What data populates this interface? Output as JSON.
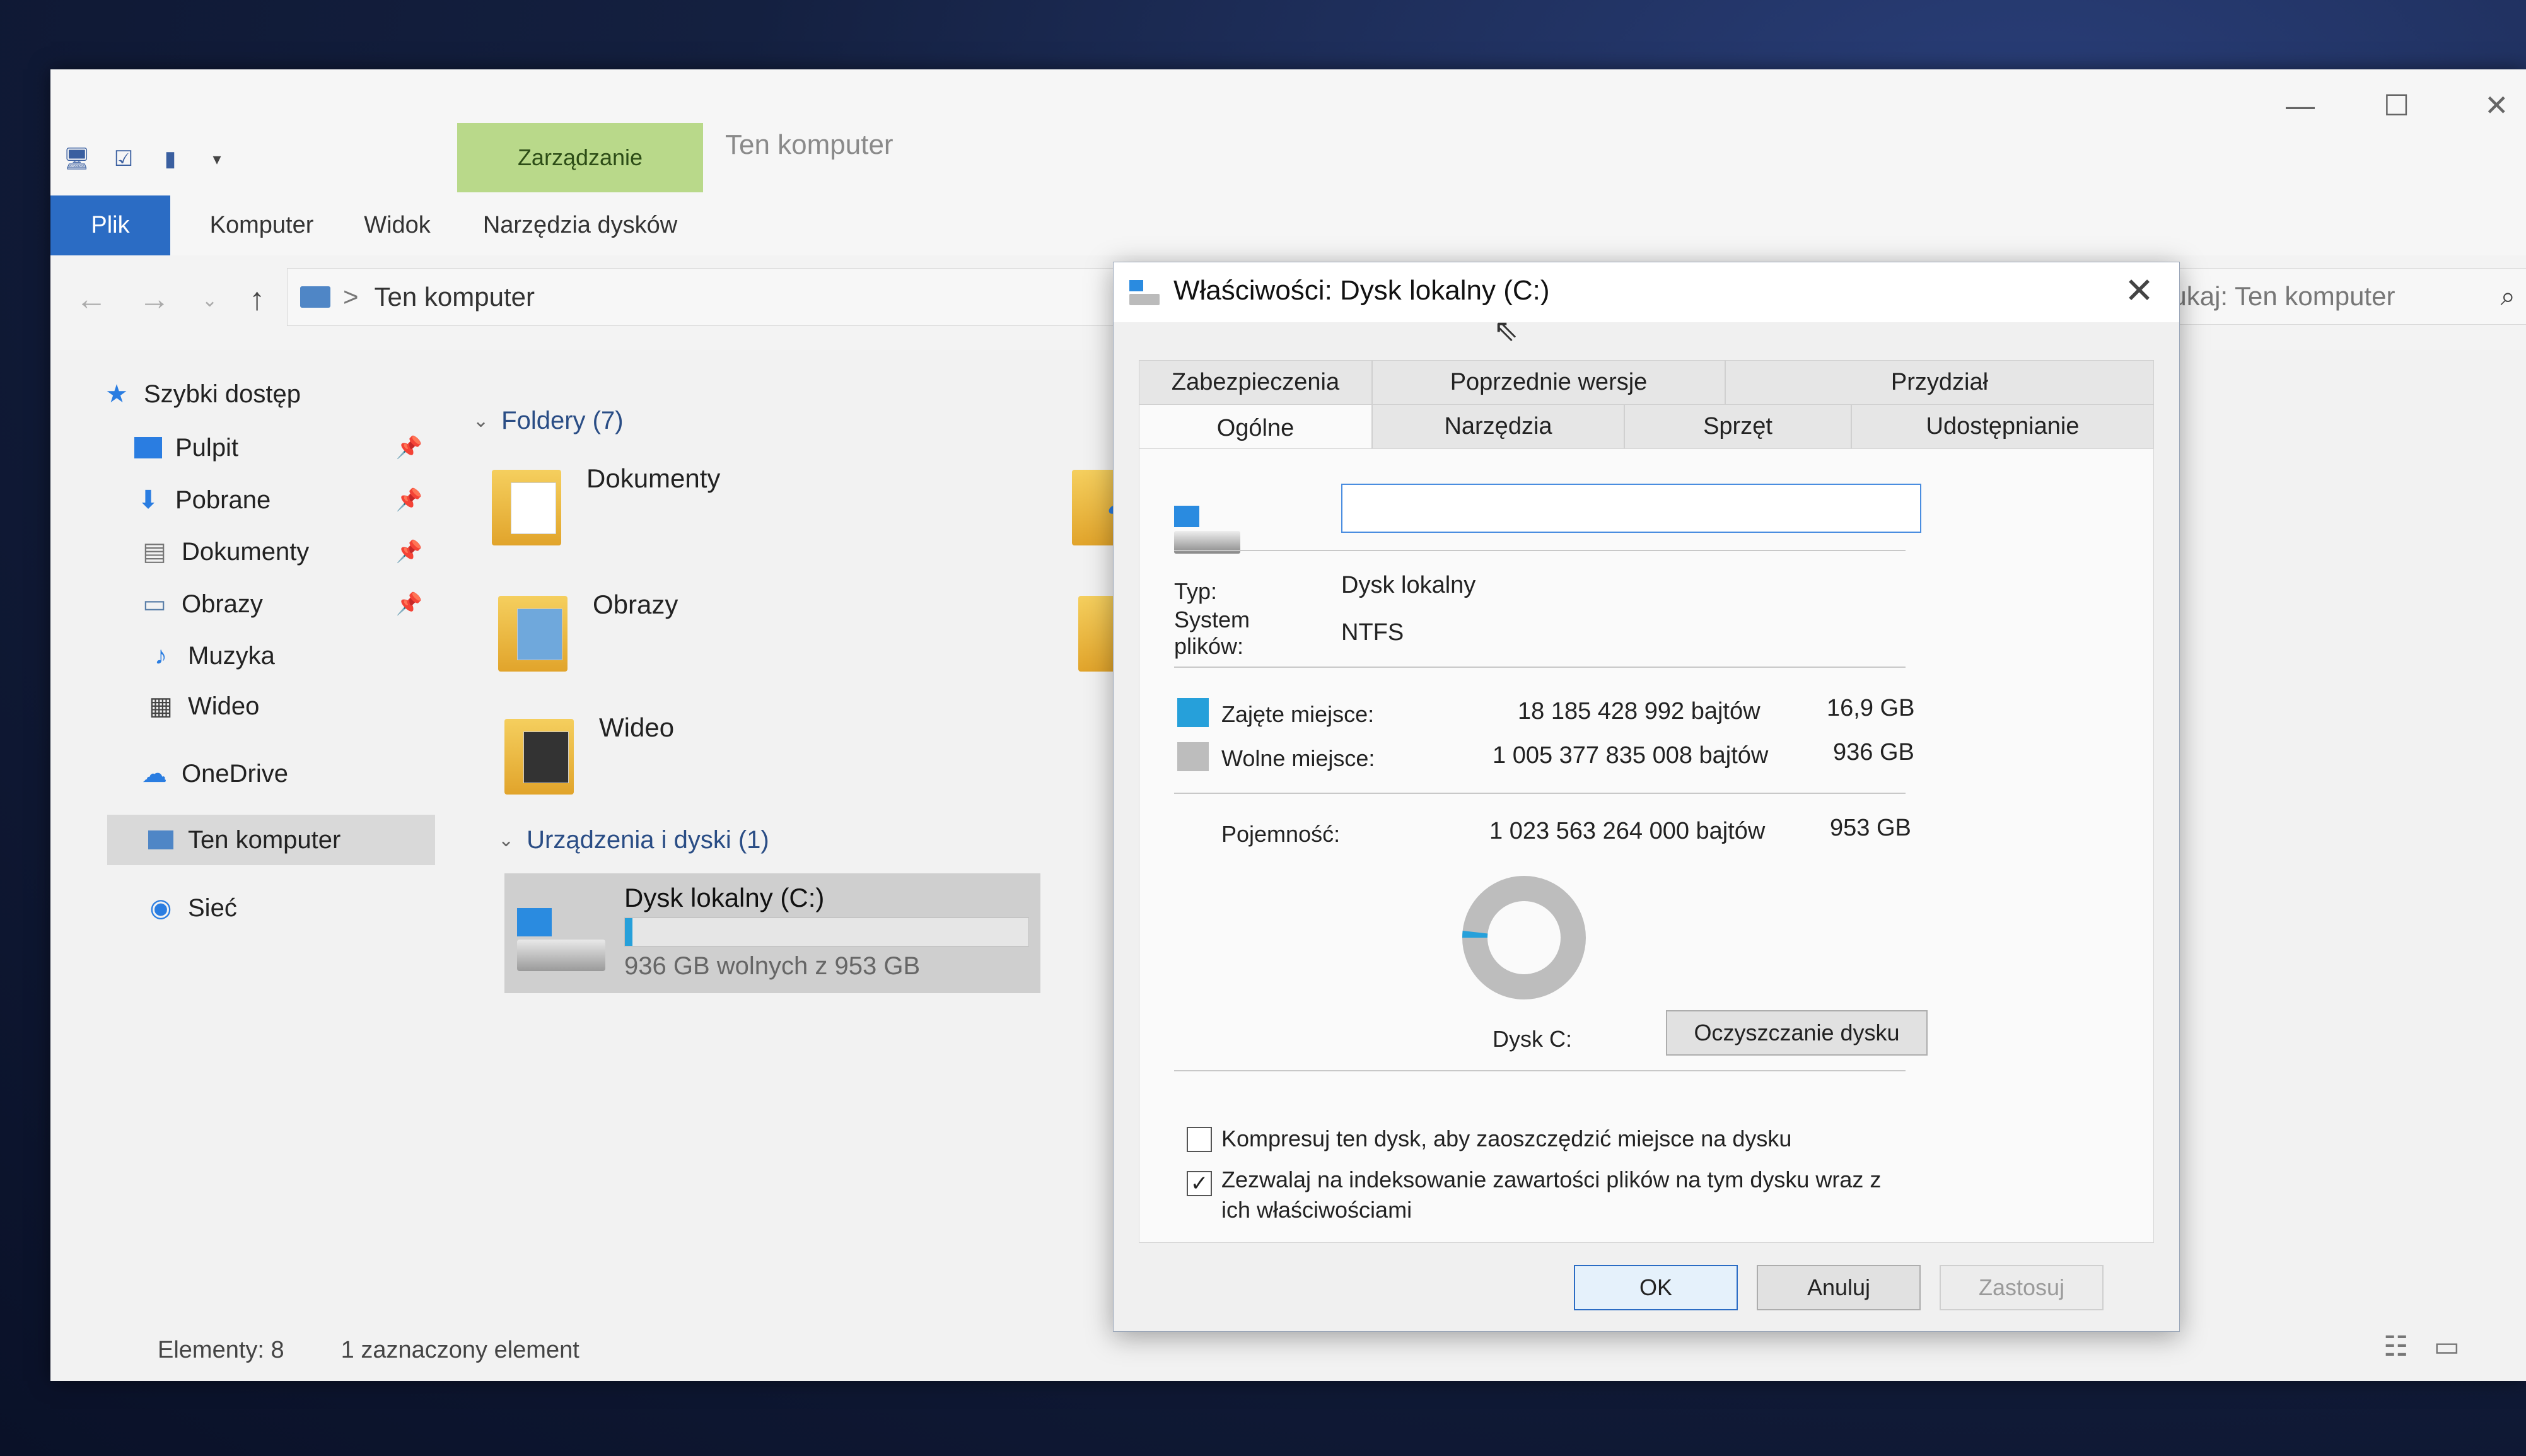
{
  "window": {
    "title": "Ten komputer",
    "manage_tab": "Zarządzanie",
    "controls": {
      "minimize": "—",
      "maximize": "☐",
      "close": "✕"
    }
  },
  "ribbon": {
    "tabs": [
      "Plik",
      "Komputer",
      "Widok",
      "Narzędzia dysków"
    ]
  },
  "address": {
    "path": "Ten komputer",
    "separator": ">",
    "search_placeholder": "Przeszukaj: Ten komputer"
  },
  "sidebar": {
    "items": [
      {
        "label": "Szybki dostęp",
        "icon": "star-icon"
      },
      {
        "label": "Pulpit",
        "icon": "desktop-icon",
        "pinned": true
      },
      {
        "label": "Pobrane",
        "icon": "download-icon",
        "pinned": true
      },
      {
        "label": "Dokumenty",
        "icon": "document-icon",
        "pinned": true
      },
      {
        "label": "Obrazy",
        "icon": "pictures-icon",
        "pinned": true
      },
      {
        "label": "Muzyka",
        "icon": "music-icon"
      },
      {
        "label": "Wideo",
        "icon": "video-icon"
      },
      {
        "label": "OneDrive",
        "icon": "cloud-icon"
      },
      {
        "label": "Ten komputer",
        "icon": "computer-icon",
        "selected": true
      },
      {
        "label": "Sieć",
        "icon": "network-icon"
      }
    ]
  },
  "content": {
    "folders_header": "Foldery (7)",
    "folders": [
      "Dokumenty",
      "Obrazy",
      "Wideo"
    ],
    "devices_header": "Urządzenia i dyski (1)",
    "drive": {
      "name": "Dysk lokalny (C:)",
      "free_text": "936 GB wolnych z 953 GB",
      "used_fraction": 0.018
    }
  },
  "statusbar": {
    "items": "Elementy: 8",
    "selected": "1 zaznaczony element"
  },
  "dialog": {
    "title": "Właściwości: Dysk lokalny (C:)",
    "close": "✕",
    "tabs_row1": [
      "Zabezpieczenia",
      "Poprzednie wersje",
      "Przydział"
    ],
    "tabs_row2": [
      "Ogólne",
      "Narzędzia",
      "Sprzęt",
      "Udostępnianie"
    ],
    "name_value": "",
    "type_label": "Typ:",
    "type_value": "Dysk lokalny",
    "fs_label": "System plików:",
    "fs_value": "NTFS",
    "used_label": "Zajęte miejsce:",
    "used_bytes": "18 185 428 992 bajtów",
    "used_gb": "16,9 GB",
    "free_label": "Wolne miejsce:",
    "free_bytes": "1 005 377 835 008 bajtów",
    "free_gb": "936 GB",
    "capacity_label": "Pojemność:",
    "capacity_bytes": "1 023 563 264 000 bajtów",
    "capacity_gb": "953 GB",
    "disk_label": "Dysk C:",
    "cleanup_button": "Oczyszczanie dysku",
    "compress_label": "Kompresuj ten dysk, aby zaoszczędzić miejsce na dysku",
    "compress_checked": false,
    "index_label": "Zezwalaj na indeksowanie zawartości plików na tym dysku wraz z ich właściwościami",
    "index_checked": true,
    "ok": "OK",
    "cancel": "Anuluj",
    "apply": "Zastosuj",
    "colors": {
      "used": "#26a0da",
      "free": "#bdbdbd"
    }
  }
}
